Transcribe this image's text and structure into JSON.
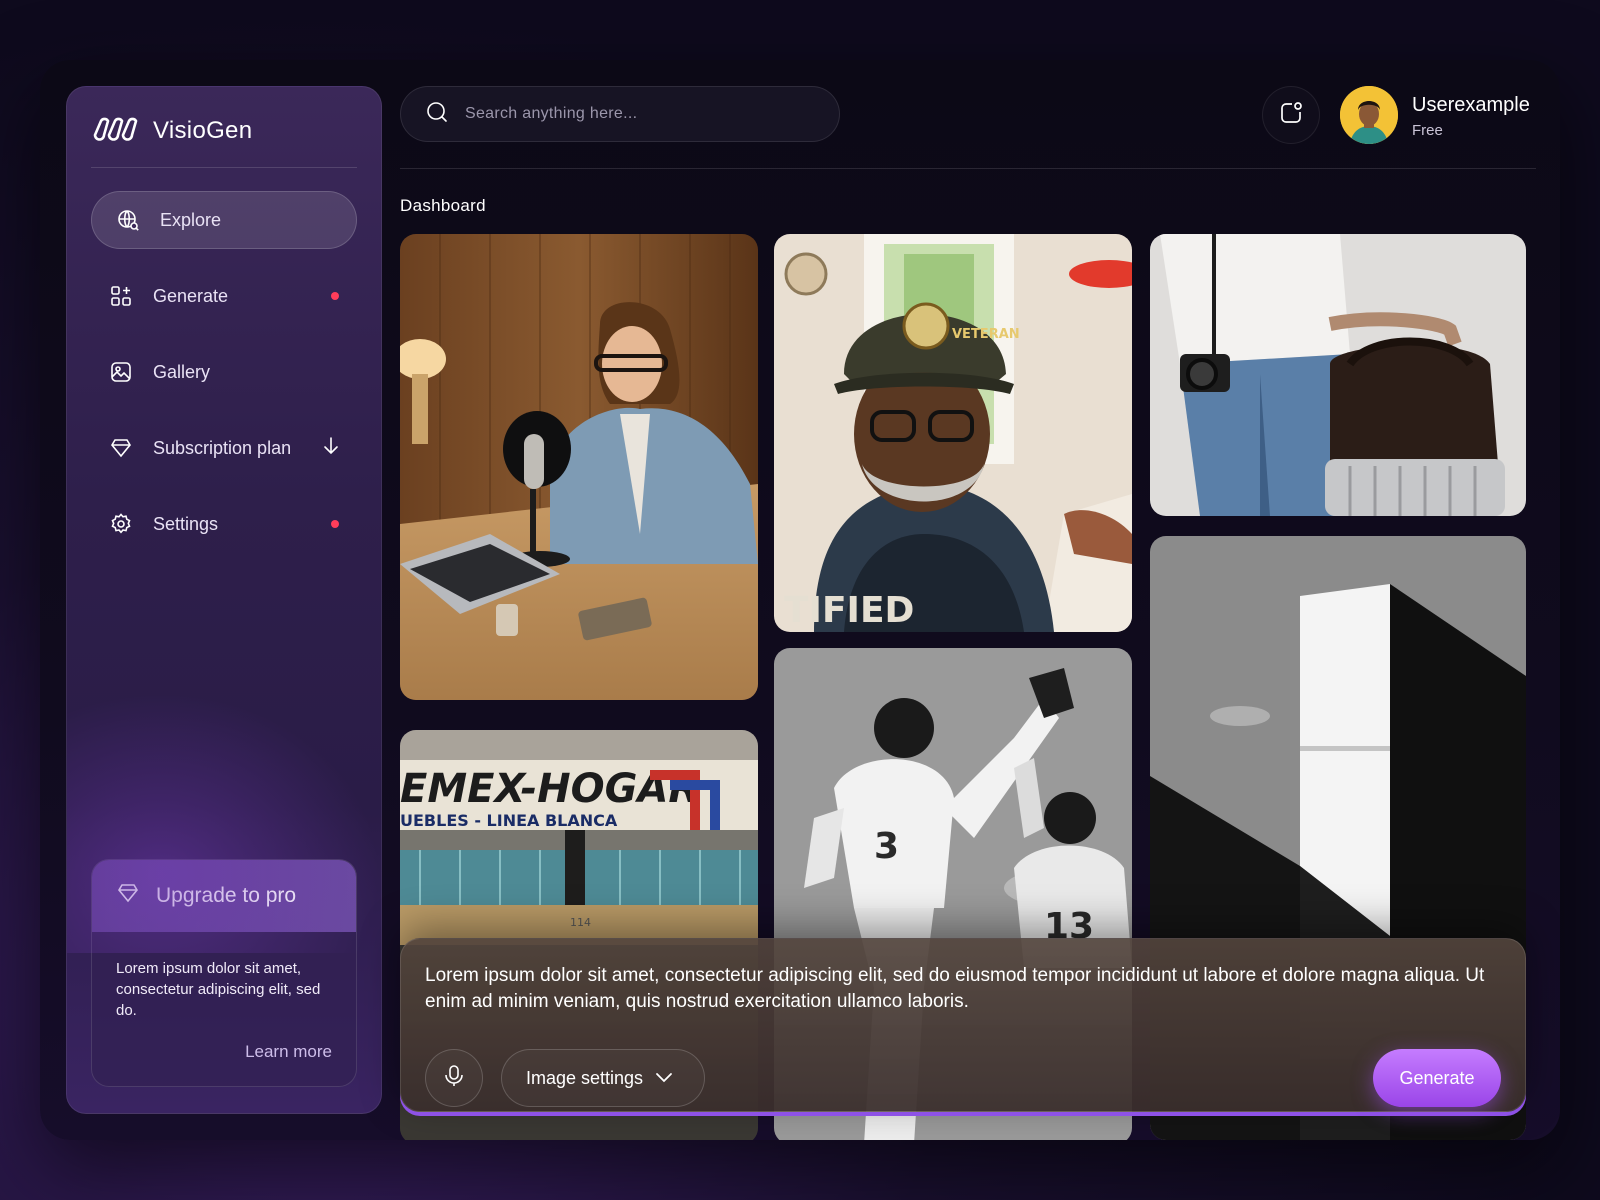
{
  "app": {
    "name": "VisioGen"
  },
  "colors": {
    "accent": "#9a45e8",
    "notification_dot": "#ff3d5a"
  },
  "sidebar": {
    "items": [
      {
        "label": "Explore",
        "icon": "globe-search-icon",
        "active": true
      },
      {
        "label": "Generate",
        "icon": "grid-sparkle-icon",
        "badge": true
      },
      {
        "label": "Gallery",
        "icon": "image-icon"
      },
      {
        "label": "Subscription plan",
        "icon": "diamond-icon",
        "expandable": true
      },
      {
        "label": "Settings",
        "icon": "gear-icon",
        "badge": true
      }
    ],
    "upgrade": {
      "title": "Upgrade to pro",
      "text": "Lorem ipsum dolor sit amet, consectetur adipiscing elit, sed do.",
      "link": "Learn more"
    }
  },
  "header": {
    "search_placeholder": "Search anything here...",
    "user": {
      "name": "Userexample",
      "plan": "Free"
    }
  },
  "main": {
    "title": "Dashboard",
    "images": [
      {
        "subject": "woman podcasting with microphone and laptop"
      },
      {
        "subject": "older man in veteran cap"
      },
      {
        "subject": "person with camera and leather bag"
      },
      {
        "subject": "store sign Mex-Hogar Muebles Linea Blanca"
      },
      {
        "subject": "football players black and white"
      },
      {
        "subject": "building corner black and white"
      }
    ],
    "sign_text": {
      "line1": "EMEX-HOGAR",
      "line2": "UEBLES - LINEA BLANCA",
      "number": "114"
    },
    "tshirt_text": "TIFIED",
    "cap_text": "VETERAN",
    "jersey_text": "13"
  },
  "prompt": {
    "text": "Lorem ipsum dolor sit amet, consectetur adipiscing elit, sed do eiusmod tempor incididunt ut labore et dolore magna aliqua. Ut enim ad minim veniam, quis nostrud exercitation ullamco laboris.",
    "settings_label": "Image settings",
    "generate_label": "Generate"
  }
}
